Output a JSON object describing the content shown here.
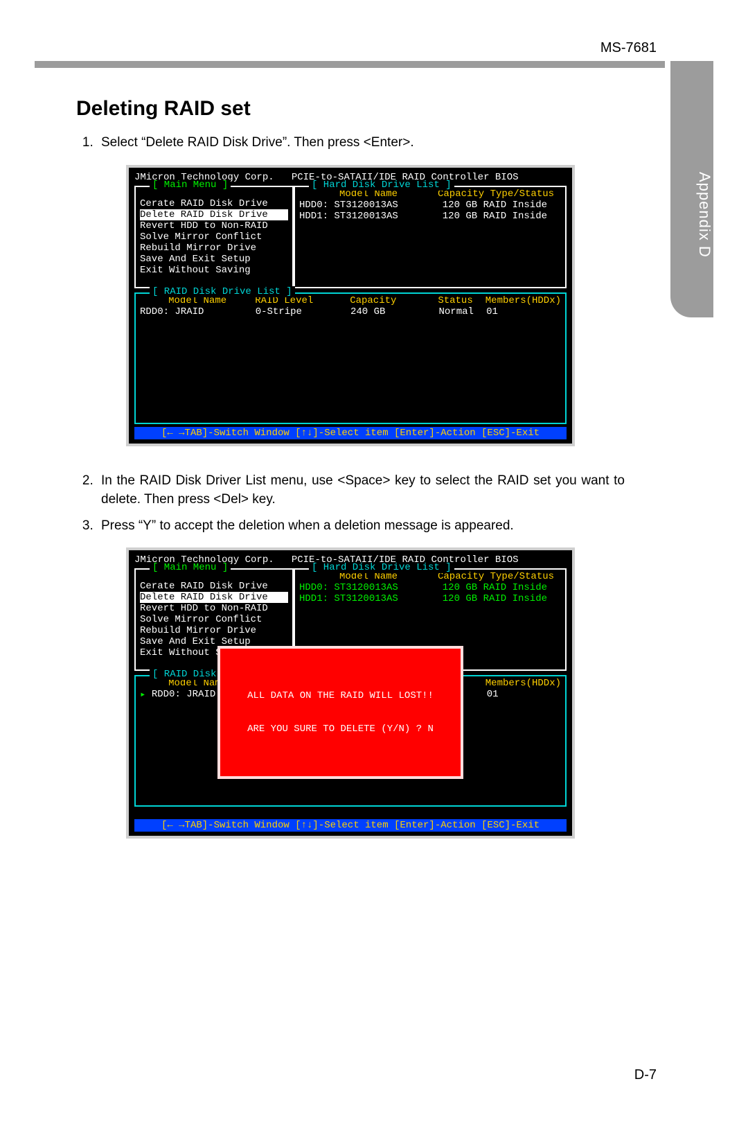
{
  "doc_code": "MS-7681",
  "side_tab": "Appendix D",
  "section_title": "Deleting RAID set",
  "steps": [
    "Select “Delete RAID Disk Drive”. Then press <Enter>.",
    "In the RAID Disk Driver List menu, use <Space> key to select the RAID set you want to delete. Then press <Del> key.",
    "Press “Y” to accept the deletion when a deletion message is appeared."
  ],
  "bios": {
    "title": "JMicron Technology Corp.   PCIE-to-SATAII/IDE RAID Controller BIOS",
    "main_legend": "[ Main Menu ]",
    "hdd_legend": "[ Hard Disk Drive List ]",
    "raid_legend": "[ RAID Disk Drive List ]",
    "menu_items": [
      "Cerate RAID Disk Drive",
      "Delete RAID Disk Drive",
      "Revert HDD to Non-RAID",
      "Solve Mirror Conflict",
      "Rebuild Mirror Drive",
      "Save And Exit Setup"
    ],
    "menu_item_last_full": "Exit Without Saving",
    "menu_item_last_trunc": "Exit Without Savi",
    "hdd_header_model": "Model Name",
    "hdd_header_cap": "Capacity Type/Status",
    "hdd_rows": [
      {
        "model": "HDD0: ST3120013AS",
        "cap_type": "120 GB RAID Inside"
      },
      {
        "model": "HDD1: ST3120013AS",
        "cap_type": "120 GB RAID Inside"
      }
    ],
    "raid_headers": {
      "model": "Model Name",
      "level": "RAID Level",
      "cap": "Capacity",
      "status": "Status",
      "members": "Members(HDDx)"
    },
    "raid_row": {
      "model": "RDD0: JRAID",
      "level": "0-Stripe",
      "cap": "240 GB",
      "status": "Normal",
      "members": "01"
    },
    "helpbar": "[← →TAB]-Switch Window [↑↓]-Select item [Enter]-Action [ESC]-Exit",
    "confirm_line1": "ALL DATA ON THE RAID WILL LOST!!",
    "confirm_line2": "ARE YOU SURE TO DELETE (Y/N) ? N"
  },
  "screen2_hdd_color": "green",
  "page_num": "D-7"
}
